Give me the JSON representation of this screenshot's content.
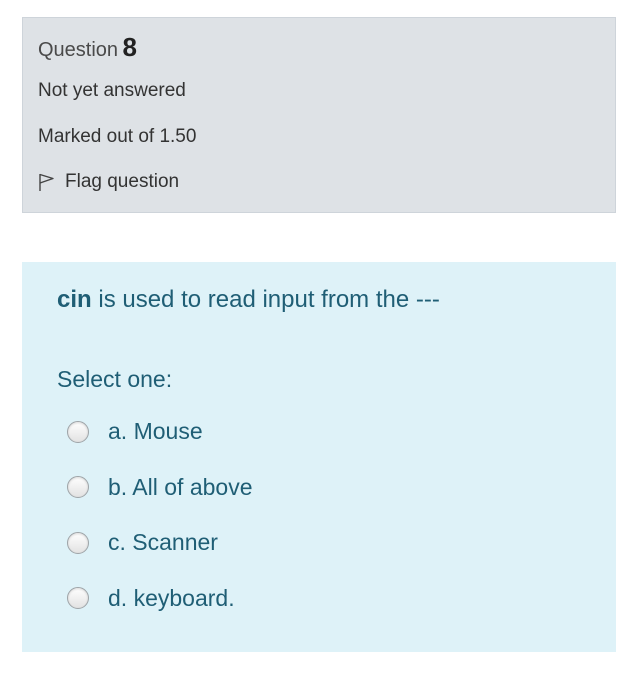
{
  "info": {
    "question_word": "Question",
    "question_number": "8",
    "state": "Not yet answered",
    "grade": "Marked out of 1.50",
    "flag_label": "Flag question",
    "flag_icon": "flag-outline-icon"
  },
  "content": {
    "question_keyword": "cin",
    "question_rest": " is used to read input from the ---",
    "prompt": "Select one:",
    "answers": [
      {
        "label": "a. Mouse",
        "selected": false
      },
      {
        "label": "b. All of above",
        "selected": false
      },
      {
        "label": "c. Scanner",
        "selected": false
      },
      {
        "label": "d. keyboard.",
        "selected": false
      }
    ]
  },
  "colors": {
    "info_background": "#dee2e6",
    "content_background": "#def2f8",
    "question_text": "#1f5e75"
  }
}
